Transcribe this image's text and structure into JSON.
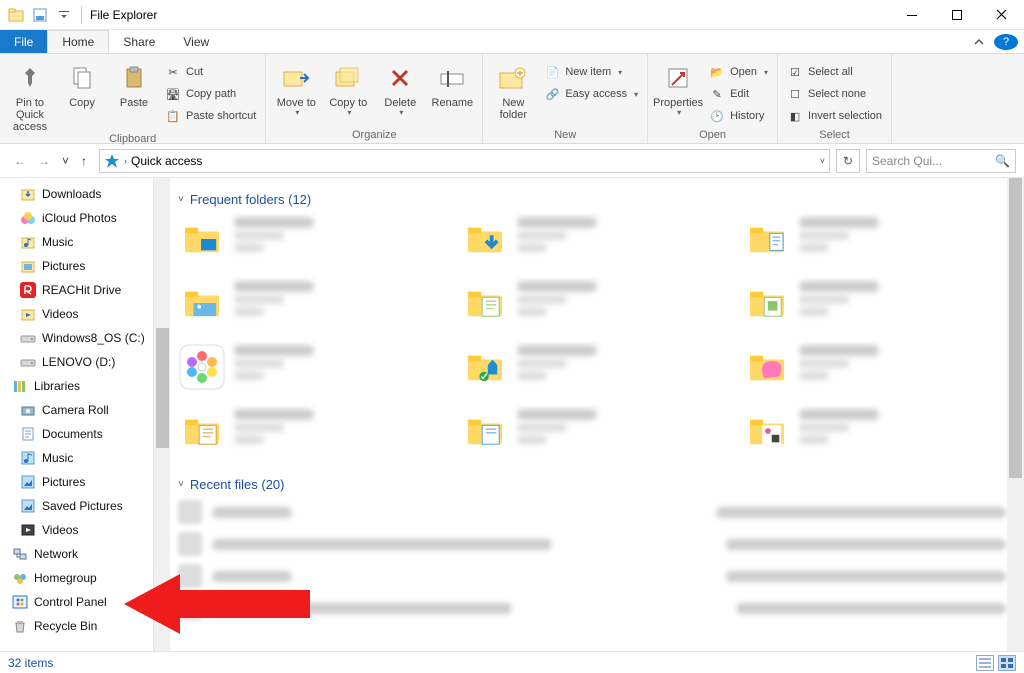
{
  "titlebar": {
    "title": "File Explorer"
  },
  "tabs": {
    "file": "File",
    "home": "Home",
    "share": "Share",
    "view": "View"
  },
  "ribbon": {
    "clipboard": {
      "label": "Clipboard",
      "pin": "Pin to Quick access",
      "copy": "Copy",
      "paste": "Paste",
      "cut": "Cut",
      "copy_path": "Copy path",
      "paste_shortcut": "Paste shortcut"
    },
    "organize": {
      "label": "Organize",
      "move": "Move to",
      "copy_to": "Copy to",
      "delete": "Delete",
      "rename": "Rename"
    },
    "new": {
      "label": "New",
      "new_folder": "New folder",
      "new_item": "New item",
      "easy_access": "Easy access"
    },
    "open": {
      "label": "Open",
      "properties": "Properties",
      "open": "Open",
      "edit": "Edit",
      "history": "History"
    },
    "select": {
      "label": "Select",
      "select_all": "Select all",
      "select_none": "Select none",
      "invert": "Invert selection"
    }
  },
  "nav": {
    "location": "Quick access",
    "search_placeholder": "Search Qui..."
  },
  "sidebar": {
    "items": [
      {
        "label": "Downloads",
        "icon": "download"
      },
      {
        "label": "iCloud Photos",
        "icon": "icloud"
      },
      {
        "label": "Music",
        "icon": "music"
      },
      {
        "label": "Pictures",
        "icon": "pictures"
      },
      {
        "label": "REACHit Drive",
        "icon": "reachit"
      },
      {
        "label": "Videos",
        "icon": "videos"
      },
      {
        "label": "Windows8_OS (C:)",
        "icon": "drive"
      },
      {
        "label": "LENOVO (D:)",
        "icon": "drive"
      },
      {
        "label": "Libraries",
        "icon": "libraries",
        "low": true
      },
      {
        "label": "Camera Roll",
        "icon": "camera"
      },
      {
        "label": "Documents",
        "icon": "documents"
      },
      {
        "label": "Music",
        "icon": "music-lib"
      },
      {
        "label": "Pictures",
        "icon": "pictures-lib"
      },
      {
        "label": "Saved Pictures",
        "icon": "pictures-lib"
      },
      {
        "label": "Videos",
        "icon": "videos-lib"
      },
      {
        "label": "Network",
        "icon": "network",
        "low": true
      },
      {
        "label": "Homegroup",
        "icon": "homegroup",
        "low": true
      },
      {
        "label": "Control Panel",
        "icon": "control-panel",
        "low": true
      },
      {
        "label": "Recycle Bin",
        "icon": "recycle",
        "low": true
      }
    ]
  },
  "content": {
    "frequent_header": "Frequent folders (12)",
    "recent_header": "Recent files (20)"
  },
  "status": {
    "items": "32 items"
  }
}
